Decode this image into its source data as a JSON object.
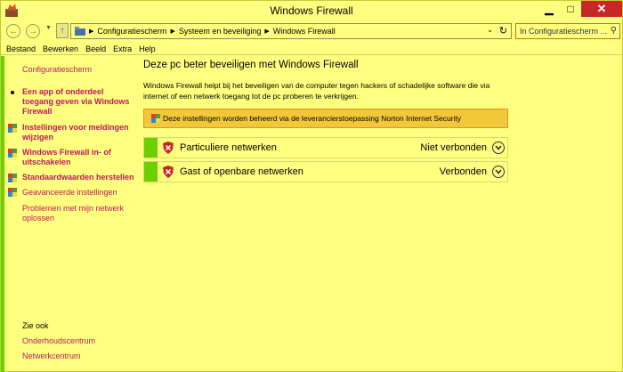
{
  "window": {
    "title": "Windows Firewall"
  },
  "addressbar": {
    "crumbs": [
      "Configuratiescherm",
      "Systeem en beveiliging",
      "Windows Firewall"
    ],
    "search_placeholder": "In Configuratiescherm ..."
  },
  "menu": {
    "items": [
      "Bestand",
      "Bewerken",
      "Beeld",
      "Extra",
      "Help"
    ]
  },
  "sidebar": {
    "home_link": "Configuratiescherm",
    "links": [
      "Een app of onderdeel toegang geven via Windows Firewall",
      "Instellingen voor meldingen wijzigen",
      "Windows Firewall in- of uitschakelen",
      "Standaardwaarden herstellen",
      "Geavanceerde instellingen",
      "Problemen met mijn netwerk oplossen"
    ],
    "see_also_label": "Zie ook",
    "see_also_links": [
      "Onderhoudscentrum",
      "Netwerkcentrum"
    ]
  },
  "main": {
    "title": "Deze pc beter beveiligen met Windows Firewall",
    "description": "Windows Firewall helpt bij het beveiligen van de computer tegen hackers of schadelijke software die via internet of een netwerk toegang tot de pc proberen te verkrijgen.",
    "banner": "Deze instellingen worden beheerd via de leverancierstoepassing Norton Internet Security",
    "networks": [
      {
        "name": "Particuliere netwerken",
        "status": "Niet verbonden"
      },
      {
        "name": "Gast of openbare netwerken",
        "status": "Verbonden"
      }
    ]
  },
  "colors": {
    "background": "#ffff80",
    "link": "#c5155c",
    "accent_green": "#6bd000",
    "banner": "#f2c83a",
    "close_button": "#c62828"
  }
}
